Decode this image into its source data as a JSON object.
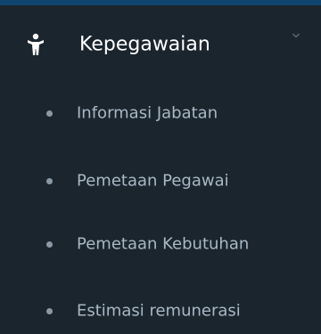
{
  "menu": {
    "header": {
      "label": "Kepegawaian",
      "icon": "person-icon",
      "expand_icon": "chevron-down-icon"
    },
    "items": [
      {
        "label": "Informasi Jabatan"
      },
      {
        "label": "Pemetaan Pegawai"
      },
      {
        "label": "Pemetaan Kebutuhan"
      },
      {
        "label": "Estimasi remunerasi"
      }
    ]
  },
  "colors": {
    "background": "#1b252e",
    "accent": "#10456f",
    "header_text": "#ffffff",
    "item_text": "#a8b8c4",
    "bullet": "#8b99a4"
  }
}
